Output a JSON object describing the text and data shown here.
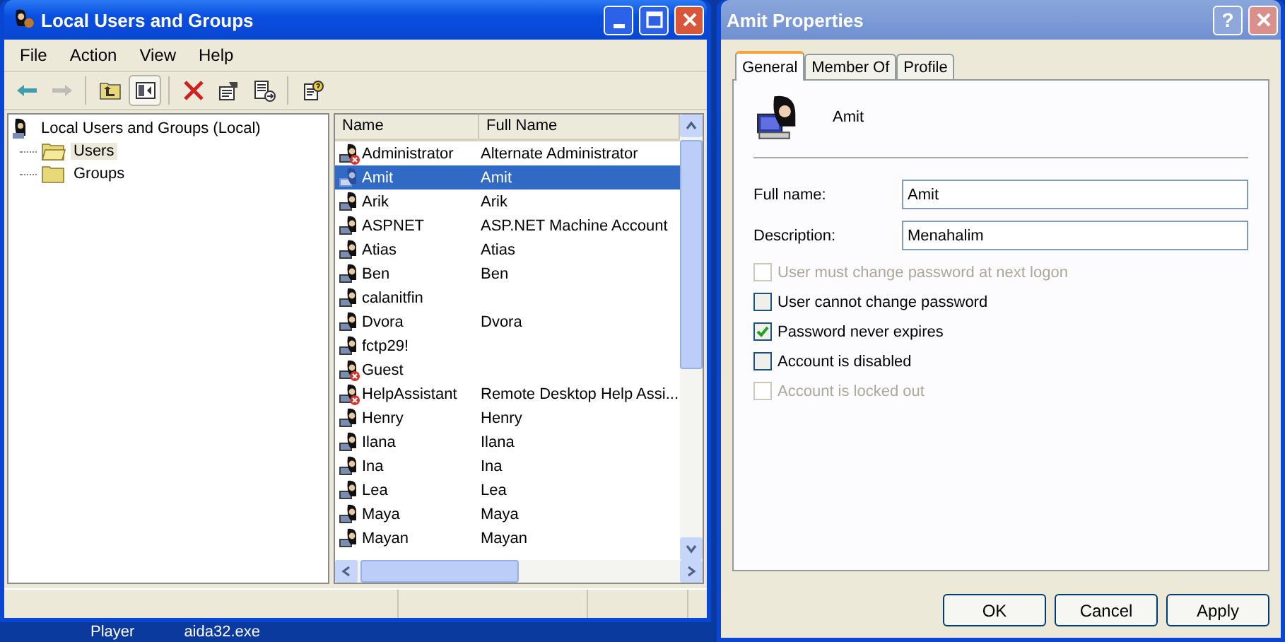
{
  "main_window": {
    "title": "Local Users and Groups",
    "menu": [
      "File",
      "Action",
      "View",
      "Help"
    ],
    "toolbar": [
      {
        "kind": "back",
        "disabled": false,
        "on": false
      },
      {
        "kind": "forward",
        "disabled": true,
        "on": false
      },
      {
        "kind": "up",
        "disabled": false,
        "on": false
      },
      {
        "kind": "tree",
        "disabled": false,
        "on": true
      },
      {
        "kind": "delete",
        "disabled": false,
        "on": false
      },
      {
        "kind": "properties",
        "disabled": false,
        "on": false
      },
      {
        "kind": "export",
        "disabled": false,
        "on": false
      },
      {
        "kind": "help",
        "disabled": false,
        "on": false
      }
    ],
    "tree": {
      "label": "Local Users and Groups (Local)",
      "children": [
        {
          "label": "Users",
          "selected": true
        },
        {
          "label": "Groups",
          "selected": false
        }
      ]
    },
    "list": {
      "columns": [
        "Name",
        "Full Name"
      ],
      "rows": [
        {
          "name": "Administrator",
          "full_name": "Alternate Administrator",
          "selected": false,
          "disabled": true
        },
        {
          "name": "Amit",
          "full_name": "Amit",
          "selected": true,
          "disabled": false
        },
        {
          "name": "Arik",
          "full_name": "Arik",
          "selected": false,
          "disabled": false
        },
        {
          "name": "ASPNET",
          "full_name": "ASP.NET Machine Account",
          "selected": false,
          "disabled": false
        },
        {
          "name": "Atias",
          "full_name": "Atias",
          "selected": false,
          "disabled": false
        },
        {
          "name": "Ben",
          "full_name": "Ben",
          "selected": false,
          "disabled": false
        },
        {
          "name": "calanitfin",
          "selected": false,
          "disabled": false
        },
        {
          "name": "Dvora",
          "full_name": "Dvora",
          "selected": false,
          "disabled": false
        },
        {
          "name": "fctp29!",
          "selected": false,
          "disabled": false
        },
        {
          "name": "Guest",
          "selected": false,
          "disabled": true
        },
        {
          "name": "HelpAssistant",
          "full_name": "Remote Desktop Help Assi...",
          "selected": false,
          "disabled": true
        },
        {
          "name": "Henry",
          "full_name": "Henry",
          "selected": false,
          "disabled": false
        },
        {
          "name": "Ilana",
          "full_name": "Ilana",
          "selected": false,
          "disabled": false
        },
        {
          "name": "Ina",
          "full_name": "Ina",
          "selected": false,
          "disabled": false
        },
        {
          "name": "Lea",
          "full_name": "Lea",
          "selected": false,
          "disabled": false
        },
        {
          "name": "Maya",
          "full_name": "Maya",
          "selected": false,
          "disabled": false
        },
        {
          "name": "Mayan",
          "full_name": "Mayan",
          "selected": false,
          "disabled": false
        }
      ]
    }
  },
  "taskbar": [
    "Player",
    "aida32.exe"
  ],
  "dialog": {
    "title": "Amit Properties",
    "help_button": "?",
    "tabs": [
      {
        "label": "General",
        "selected": true
      },
      {
        "label": "Member Of",
        "selected": false
      },
      {
        "label": "Profile",
        "selected": false
      }
    ],
    "user_name": "Amit",
    "fields": [
      {
        "label": "Full name:",
        "value": "Amit"
      },
      {
        "label": "Description:",
        "value": "Menahalim"
      }
    ],
    "options": [
      {
        "label": "User must change password at next logon",
        "checked": false,
        "disabled": true
      },
      {
        "label": "User cannot change password",
        "checked": false,
        "disabled": false
      },
      {
        "label": "Password never expires",
        "checked": true,
        "disabled": false
      },
      {
        "label": "Account is disabled",
        "checked": false,
        "disabled": false
      },
      {
        "label": "Account is locked out",
        "checked": false,
        "disabled": true
      }
    ],
    "buttons": [
      "OK",
      "Cancel",
      "Apply"
    ]
  }
}
